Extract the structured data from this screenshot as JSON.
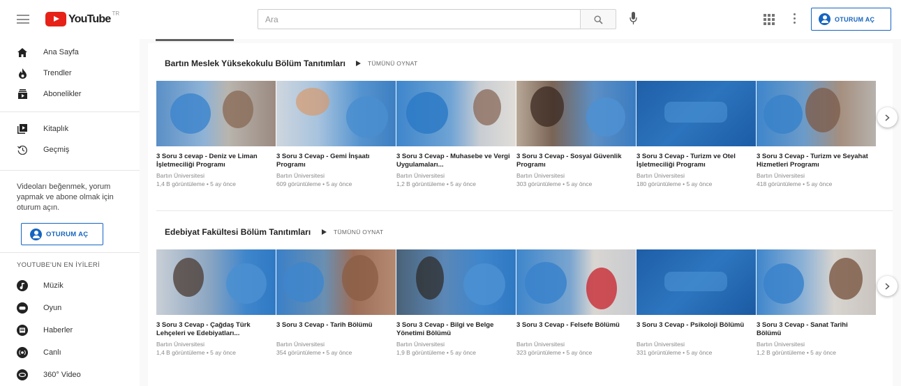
{
  "header": {
    "logo_text": "YouTube",
    "logo_sup": "TR",
    "search_placeholder": "Ara",
    "signin_label": "OTURUM AÇ"
  },
  "sidebar": {
    "items": [
      {
        "label": "Ana Sayfa",
        "icon": "home-icon"
      },
      {
        "label": "Trendler",
        "icon": "flame-icon"
      },
      {
        "label": "Abonelikler",
        "icon": "subscriptions-icon"
      },
      {
        "label": "Kitaplık",
        "icon": "library-icon"
      },
      {
        "label": "Geçmiş",
        "icon": "history-icon"
      }
    ],
    "signin_message": "Videoları beğenmek, yorum yapmak ve abone olmak için oturum açın.",
    "signin_label": "OTURUM AÇ",
    "best_heading": "YOUTUBE'UN EN İYİLERİ",
    "categories": [
      {
        "label": "Müzik",
        "icon": "music-icon"
      },
      {
        "label": "Oyun",
        "icon": "gaming-icon"
      },
      {
        "label": "Haberler",
        "icon": "news-icon"
      },
      {
        "label": "Canlı",
        "icon": "live-icon"
      },
      {
        "label": "360° Video",
        "icon": "video-360-icon"
      }
    ]
  },
  "shelves": [
    {
      "title": "Bartın Meslek Yüksekokulu Bölüm Tanıtımları",
      "play_all": "TÜMÜNÜ OYNAT",
      "videos": [
        {
          "title": "3 Soru 3 cevap - Deniz ve Liman İşletmeciliği Programı",
          "channel": "Bartın Üniversitesi",
          "meta": "1,4 B görüntüleme • 5 ay önce"
        },
        {
          "title": "3 Soru 3 Cevap - Gemi İnşaatı Programı",
          "channel": "Bartın Üniversitesi",
          "meta": "609 görüntüleme • 5 ay önce"
        },
        {
          "title": "3 Soru 3 Cevap - Muhasebe ve Vergi Uygulamaları...",
          "channel": "Bartın Üniversitesi",
          "meta": "1,2 B görüntüleme • 5 ay önce"
        },
        {
          "title": "3 Soru 3 Cevap - Sosyal Güvenlik Programı",
          "channel": "Bartın Üniversitesi",
          "meta": "303 görüntüleme • 5 ay önce"
        },
        {
          "title": "3 Soru 3 Cevap - Turizm ve Otel İşletmeciliği Programı",
          "channel": "Bartın Üniversitesi",
          "meta": "180 görüntüleme • 5 ay önce"
        },
        {
          "title": "3 Soru 3 Cevap - Turizm ve Seyahat Hizmetleri Programı",
          "channel": "Bartın Üniversitesi",
          "meta": "418 görüntüleme • 5 ay önce"
        }
      ]
    },
    {
      "title": "Edebiyat Fakültesi Bölüm Tanıtımları",
      "play_all": "TÜMÜNÜ OYNAT",
      "videos": [
        {
          "title": "3 Soru 3 Cevap - Çağdaş Türk Lehçeleri ve Edebiyatları...",
          "channel": "Bartın Üniversitesi",
          "meta": "1,4 B görüntüleme • 5 ay önce"
        },
        {
          "title": "3 Soru 3 Cevap - Tarih Bölümü",
          "channel": "Bartın Üniversitesi",
          "meta": "354 görüntüleme • 5 ay önce"
        },
        {
          "title": "3 Soru 3 Cevap - Bilgi ve Belge Yönetimi Bölümü",
          "channel": "Bartın Üniversitesi",
          "meta": "1,9 B görüntüleme • 5 ay önce"
        },
        {
          "title": "3 Soru 3 Cevap - Felsefe Bölümü",
          "channel": "Bartın Üniversitesi",
          "meta": "323 görüntüleme • 5 ay önce"
        },
        {
          "title": "3 Soru 3 Cevap - Psikoloji Bölümü",
          "channel": "Bartın Üniversitesi",
          "meta": "331 görüntüleme • 5 ay önce"
        },
        {
          "title": "3 Soru 3 Cevap - Sanat Tarihi Bölümü",
          "channel": "Bartın Üniversitesi",
          "meta": "1,2 B görüntüleme • 5 ay önce"
        }
      ]
    }
  ],
  "colors": {
    "brand_red": "#e62117",
    "accent_blue": "#1565c0",
    "thumb_blue": "#2b7bc4"
  }
}
